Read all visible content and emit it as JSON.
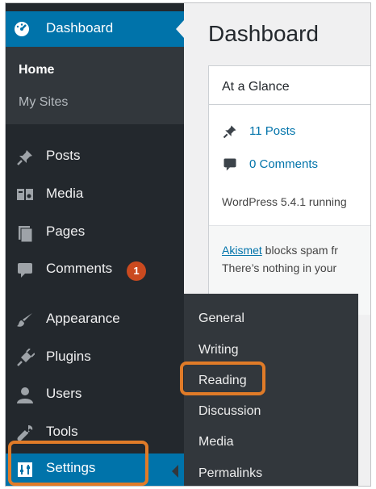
{
  "sidebar": {
    "dashboard_label": "Dashboard",
    "submenu": {
      "home": "Home",
      "my_sites": "My Sites"
    },
    "items": [
      {
        "label": "Posts",
        "icon": "pushpin-icon"
      },
      {
        "label": "Media",
        "icon": "media-icon"
      },
      {
        "label": "Pages",
        "icon": "pages-icon"
      },
      {
        "label": "Comments",
        "icon": "comment-icon",
        "badge": "1"
      },
      {
        "label": "Appearance",
        "icon": "brush-icon"
      },
      {
        "label": "Plugins",
        "icon": "plug-icon"
      },
      {
        "label": "Users",
        "icon": "user-icon"
      },
      {
        "label": "Tools",
        "icon": "wrench-icon"
      },
      {
        "label": "Settings",
        "icon": "settings-icon"
      }
    ]
  },
  "flyout": {
    "items": [
      "General",
      "Writing",
      "Reading",
      "Discussion",
      "Media",
      "Permalinks"
    ]
  },
  "main": {
    "title": "Dashboard",
    "panel": {
      "title": "At a Glance",
      "posts": "11 Posts",
      "comments": "0 Comments",
      "wp_version": "WordPress 5.4.1 running",
      "akismet_link": "Akismet",
      "akismet_text": " blocks spam fr",
      "nothing_text": "There’s nothing in your"
    }
  },
  "colors": {
    "sidebar_bg": "#23282d",
    "submenu_bg": "#32373c",
    "accent": "#0073aa",
    "badge": "#ca4a1f",
    "highlight": "#e07b28"
  }
}
